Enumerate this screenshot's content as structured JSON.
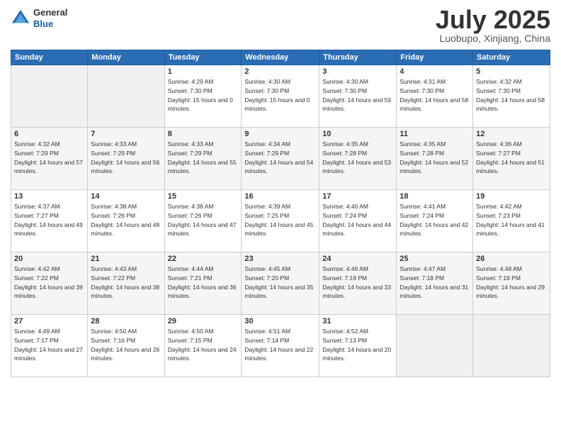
{
  "header": {
    "logo_general": "General",
    "logo_blue": "Blue",
    "month_title": "July 2025",
    "location": "Luobupo, Xinjiang, China"
  },
  "weekdays": [
    "Sunday",
    "Monday",
    "Tuesday",
    "Wednesday",
    "Thursday",
    "Friday",
    "Saturday"
  ],
  "weeks": [
    [
      {
        "day": "",
        "empty": true
      },
      {
        "day": "",
        "empty": true
      },
      {
        "day": "1",
        "sunrise": "Sunrise: 4:29 AM",
        "sunset": "Sunset: 7:30 PM",
        "daylight": "Daylight: 15 hours and 0 minutes."
      },
      {
        "day": "2",
        "sunrise": "Sunrise: 4:30 AM",
        "sunset": "Sunset: 7:30 PM",
        "daylight": "Daylight: 15 hours and 0 minutes."
      },
      {
        "day": "3",
        "sunrise": "Sunrise: 4:30 AM",
        "sunset": "Sunset: 7:30 PM",
        "daylight": "Daylight: 14 hours and 59 minutes."
      },
      {
        "day": "4",
        "sunrise": "Sunrise: 4:31 AM",
        "sunset": "Sunset: 7:30 PM",
        "daylight": "Daylight: 14 hours and 58 minutes."
      },
      {
        "day": "5",
        "sunrise": "Sunrise: 4:32 AM",
        "sunset": "Sunset: 7:30 PM",
        "daylight": "Daylight: 14 hours and 58 minutes."
      }
    ],
    [
      {
        "day": "6",
        "sunrise": "Sunrise: 4:32 AM",
        "sunset": "Sunset: 7:29 PM",
        "daylight": "Daylight: 14 hours and 57 minutes."
      },
      {
        "day": "7",
        "sunrise": "Sunrise: 4:33 AM",
        "sunset": "Sunset: 7:29 PM",
        "daylight": "Daylight: 14 hours and 56 minutes."
      },
      {
        "day": "8",
        "sunrise": "Sunrise: 4:33 AM",
        "sunset": "Sunset: 7:29 PM",
        "daylight": "Daylight: 14 hours and 55 minutes."
      },
      {
        "day": "9",
        "sunrise": "Sunrise: 4:34 AM",
        "sunset": "Sunset: 7:29 PM",
        "daylight": "Daylight: 14 hours and 54 minutes."
      },
      {
        "day": "10",
        "sunrise": "Sunrise: 4:35 AM",
        "sunset": "Sunset: 7:28 PM",
        "daylight": "Daylight: 14 hours and 53 minutes."
      },
      {
        "day": "11",
        "sunrise": "Sunrise: 4:35 AM",
        "sunset": "Sunset: 7:28 PM",
        "daylight": "Daylight: 14 hours and 52 minutes."
      },
      {
        "day": "12",
        "sunrise": "Sunrise: 4:36 AM",
        "sunset": "Sunset: 7:27 PM",
        "daylight": "Daylight: 14 hours and 51 minutes."
      }
    ],
    [
      {
        "day": "13",
        "sunrise": "Sunrise: 4:37 AM",
        "sunset": "Sunset: 7:27 PM",
        "daylight": "Daylight: 14 hours and 49 minutes."
      },
      {
        "day": "14",
        "sunrise": "Sunrise: 4:38 AM",
        "sunset": "Sunset: 7:26 PM",
        "daylight": "Daylight: 14 hours and 48 minutes."
      },
      {
        "day": "15",
        "sunrise": "Sunrise: 4:38 AM",
        "sunset": "Sunset: 7:26 PM",
        "daylight": "Daylight: 14 hours and 47 minutes."
      },
      {
        "day": "16",
        "sunrise": "Sunrise: 4:39 AM",
        "sunset": "Sunset: 7:25 PM",
        "daylight": "Daylight: 14 hours and 45 minutes."
      },
      {
        "day": "17",
        "sunrise": "Sunrise: 4:40 AM",
        "sunset": "Sunset: 7:24 PM",
        "daylight": "Daylight: 14 hours and 44 minutes."
      },
      {
        "day": "18",
        "sunrise": "Sunrise: 4:41 AM",
        "sunset": "Sunset: 7:24 PM",
        "daylight": "Daylight: 14 hours and 42 minutes."
      },
      {
        "day": "19",
        "sunrise": "Sunrise: 4:42 AM",
        "sunset": "Sunset: 7:23 PM",
        "daylight": "Daylight: 14 hours and 41 minutes."
      }
    ],
    [
      {
        "day": "20",
        "sunrise": "Sunrise: 4:42 AM",
        "sunset": "Sunset: 7:22 PM",
        "daylight": "Daylight: 14 hours and 39 minutes."
      },
      {
        "day": "21",
        "sunrise": "Sunrise: 4:43 AM",
        "sunset": "Sunset: 7:22 PM",
        "daylight": "Daylight: 14 hours and 38 minutes."
      },
      {
        "day": "22",
        "sunrise": "Sunrise: 4:44 AM",
        "sunset": "Sunset: 7:21 PM",
        "daylight": "Daylight: 14 hours and 36 minutes."
      },
      {
        "day": "23",
        "sunrise": "Sunrise: 4:45 AM",
        "sunset": "Sunset: 7:20 PM",
        "daylight": "Daylight: 14 hours and 35 minutes."
      },
      {
        "day": "24",
        "sunrise": "Sunrise: 4:46 AM",
        "sunset": "Sunset: 7:19 PM",
        "daylight": "Daylight: 14 hours and 33 minutes."
      },
      {
        "day": "25",
        "sunrise": "Sunrise: 4:47 AM",
        "sunset": "Sunset: 7:18 PM",
        "daylight": "Daylight: 14 hours and 31 minutes."
      },
      {
        "day": "26",
        "sunrise": "Sunrise: 4:48 AM",
        "sunset": "Sunset: 7:18 PM",
        "daylight": "Daylight: 14 hours and 29 minutes."
      }
    ],
    [
      {
        "day": "27",
        "sunrise": "Sunrise: 4:49 AM",
        "sunset": "Sunset: 7:17 PM",
        "daylight": "Daylight: 14 hours and 27 minutes."
      },
      {
        "day": "28",
        "sunrise": "Sunrise: 4:50 AM",
        "sunset": "Sunset: 7:16 PM",
        "daylight": "Daylight: 14 hours and 26 minutes."
      },
      {
        "day": "29",
        "sunrise": "Sunrise: 4:50 AM",
        "sunset": "Sunset: 7:15 PM",
        "daylight": "Daylight: 14 hours and 24 minutes."
      },
      {
        "day": "30",
        "sunrise": "Sunrise: 4:51 AM",
        "sunset": "Sunset: 7:14 PM",
        "daylight": "Daylight: 14 hours and 22 minutes."
      },
      {
        "day": "31",
        "sunrise": "Sunrise: 4:52 AM",
        "sunset": "Sunset: 7:13 PM",
        "daylight": "Daylight: 14 hours and 20 minutes."
      },
      {
        "day": "",
        "empty": true
      },
      {
        "day": "",
        "empty": true
      }
    ]
  ]
}
